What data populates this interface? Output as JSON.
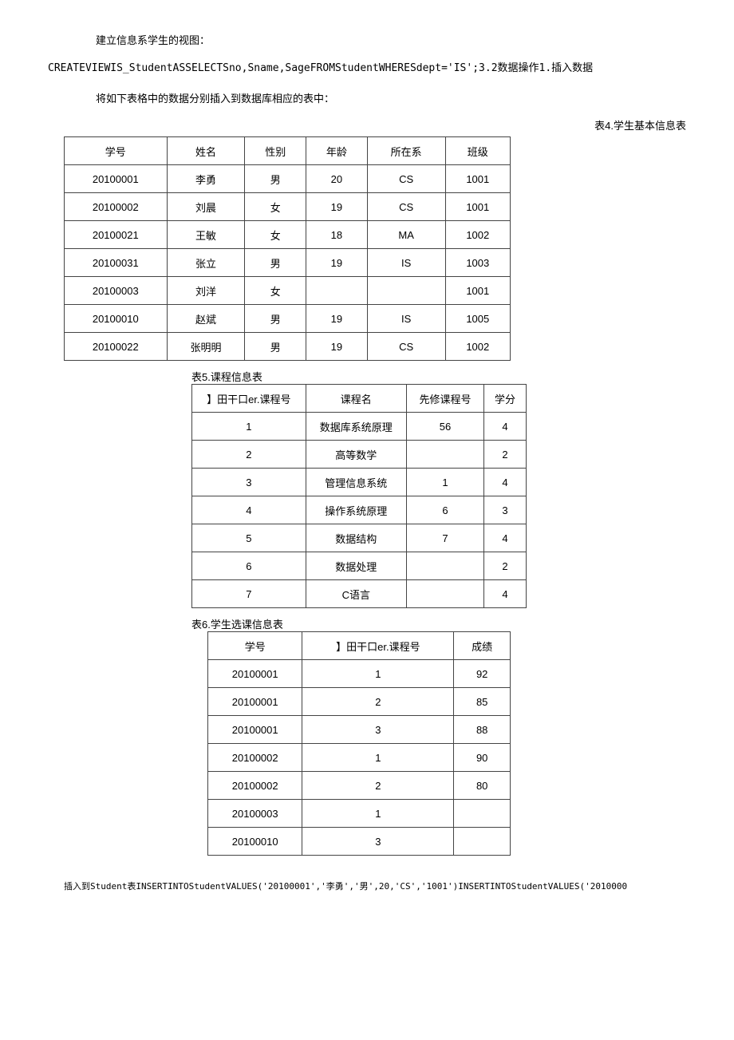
{
  "para1": "建立信息系学生的视图：",
  "code1": "CREATEVIEWIS_StudentASSELECTSno,Sname,SageFROMStudentWHERESdept='IS';3.2数据操作1.插入数据",
  "para2": "将如下表格中的数据分别插入到数据库相应的表中：",
  "table4_caption": "表4.学生基本信息表",
  "table4": {
    "headers": [
      "学号",
      "姓名",
      "性别",
      "年龄",
      "所在系",
      "班级"
    ],
    "rows": [
      [
        "20100001",
        "李勇",
        "男",
        "20",
        "CS",
        "1001"
      ],
      [
        "20100002",
        "刘晨",
        "女",
        "19",
        "CS",
        "1001"
      ],
      [
        "20100021",
        "王敏",
        "女",
        "18",
        "MA",
        "1002"
      ],
      [
        "20100031",
        "张立",
        "男",
        "19",
        "IS",
        "1003"
      ],
      [
        "20100003",
        "刘洋",
        "女",
        "",
        "",
        "1001"
      ],
      [
        "20100010",
        "赵斌",
        "男",
        "19",
        "IS",
        "1005"
      ],
      [
        "20100022",
        "张明明",
        "男",
        "19",
        "CS",
        "1002"
      ]
    ]
  },
  "table5_caption": "表5.课程信息表",
  "table5": {
    "headers": [
      "】田干口er.课程号",
      "课程名",
      "先修课程号",
      "学分"
    ],
    "rows": [
      [
        "1",
        "数据库系统原理",
        "56",
        "4"
      ],
      [
        "2",
        "高等数学",
        "",
        "2"
      ],
      [
        "3",
        "管理信息系统",
        "1",
        "4"
      ],
      [
        "4",
        "操作系统原理",
        "6",
        "3"
      ],
      [
        "5",
        "数据结构",
        "7",
        "4"
      ],
      [
        "6",
        "数据处理",
        "",
        "2"
      ],
      [
        "7",
        "C语言",
        "",
        "4"
      ]
    ]
  },
  "table6_caption": "表6.学生选课信息表",
  "table6": {
    "headers": [
      "学号",
      "】田干口er.课程号",
      "成绩"
    ],
    "rows": [
      [
        "20100001",
        "1",
        "92"
      ],
      [
        "20100001",
        "2",
        "85"
      ],
      [
        "20100001",
        "3",
        "88"
      ],
      [
        "20100002",
        "1",
        "90"
      ],
      [
        "20100002",
        "2",
        "80"
      ],
      [
        "20100003",
        "1",
        ""
      ],
      [
        "20100010",
        "3",
        ""
      ]
    ]
  },
  "footer_code": "插入到Student表INSERTINTOStudentVALUES('20100001','李勇','男',20,'CS','1001')INSERTINTOStudentVALUES('2010000"
}
